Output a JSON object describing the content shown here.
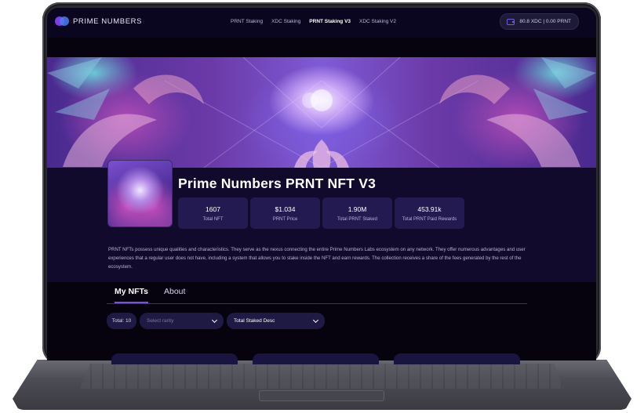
{
  "brand": {
    "name": "PRIME NUMBERS"
  },
  "nav": {
    "items": [
      {
        "label": "PRNT Staking",
        "active": false
      },
      {
        "label": "XDC Staking",
        "active": false
      },
      {
        "label": "PRNT Staking V3",
        "active": true
      },
      {
        "label": "XDC Staking V2",
        "active": false
      }
    ]
  },
  "wallet": {
    "balance": "80.8 XDC | 0.00 PRNT",
    "icon": "wallet-icon"
  },
  "collection": {
    "title": "Prime Numbers PRNT NFT V3",
    "stats": [
      {
        "value": "1607",
        "label": "Total NFT"
      },
      {
        "value": "$1.034",
        "label": "PRNT Price"
      },
      {
        "value": "1.90M",
        "label": "Total PRNT Staked"
      },
      {
        "value": "453.91k",
        "label": "Total PRNT Paid Rewards"
      }
    ],
    "description": "PRNT NFTs possess unique qualities and characteristics. They serve as the nexus connecting the entire Prime Numbers Labs ecosystem on any network. They offer numerous advantages and user experiences that a regular user does not have, including a system that allows you to stake inside the NFT and earn rewards. The collection receives a share of the fees generated by the rest of the ecosystem."
  },
  "tabs": [
    {
      "label": "My NFTs",
      "active": true
    },
    {
      "label": "About",
      "active": false
    }
  ],
  "filters": {
    "total": "Total: 10",
    "rarity_placeholder": "Select rarity",
    "sort_value": "Total Staked Desc"
  },
  "colors": {
    "background": "#06030f",
    "panel": "#231a52",
    "accent": "#7b4fe8"
  }
}
